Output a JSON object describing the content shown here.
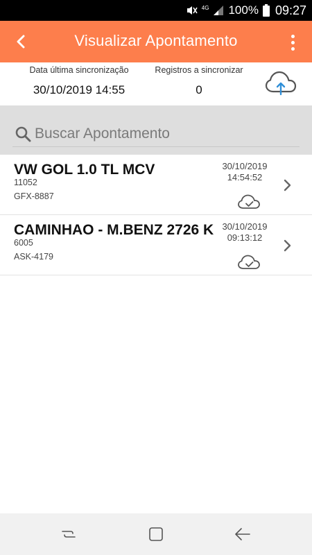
{
  "status_bar": {
    "battery": "100%",
    "time": "09:27",
    "network": "4G"
  },
  "app_bar": {
    "title": "Visualizar Apontamento"
  },
  "sync": {
    "last_sync_label": "Data última sincronização",
    "last_sync_value": "30/10/2019 14:55",
    "pending_label": "Registros a sincronizar",
    "pending_value": "0"
  },
  "search": {
    "placeholder": "Buscar Apontamento"
  },
  "items": [
    {
      "title": "VW GOL 1.0 TL MCV",
      "code": "11052",
      "plate": "GFX-8887",
      "date": "30/10/2019",
      "time": "14:54:52"
    },
    {
      "title": "CAMINHAO - M.BENZ 2726 K",
      "code": "6005",
      "plate": "ASK-4179",
      "date": "30/10/2019",
      "time": "09:13:12"
    }
  ],
  "colors": {
    "accent": "#fd7e4c",
    "upload_arrow": "#2f8fd8",
    "icon_gray": "#555555"
  }
}
